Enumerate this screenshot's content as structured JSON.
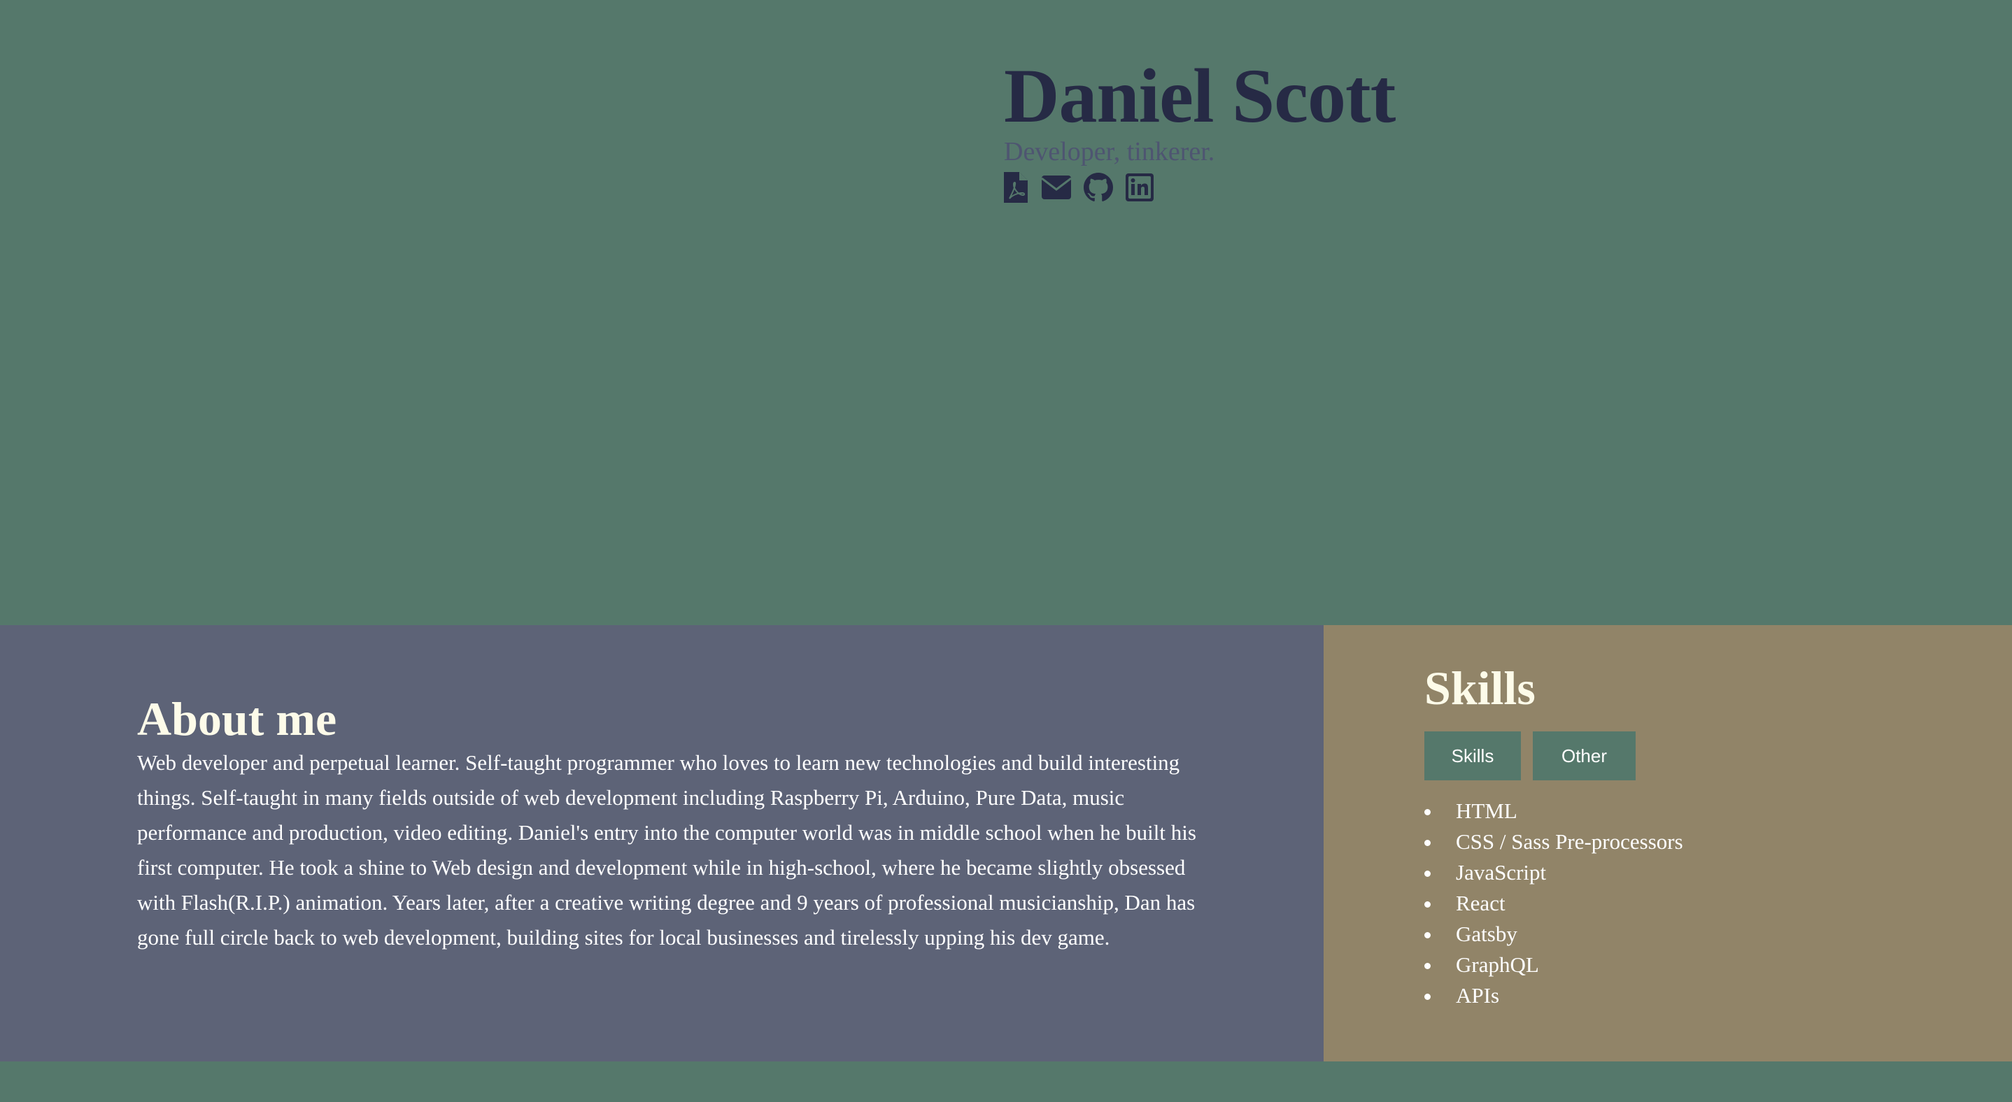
{
  "hero": {
    "name": "Daniel Scott",
    "tagline": "Developer, tinkerer.",
    "links": [
      {
        "icon": "pdf-file-icon"
      },
      {
        "icon": "envelope-icon"
      },
      {
        "icon": "github-icon"
      },
      {
        "icon": "linkedin-icon"
      }
    ]
  },
  "about": {
    "title": "About me",
    "text": "Web developer and perpetual learner. Self-taught programmer who loves to learn new technologies and build interesting things. Self-taught in many fields outside of web development including Raspberry Pi, Arduino, Pure Data, music performance and production, video editing. Daniel's entry into the computer world was in middle school when he built his first computer. He took a shine to Web design and development while in high-school, where he became slightly obsessed with Flash(R.I.P.) animation. Years later, after a creative writing degree and 9 years of professional musicianship, Dan has gone full circle back to web development, building sites for local businesses and tirelessly upping his dev game."
  },
  "skills": {
    "title": "Skills",
    "tabs": [
      "Skills",
      "Other"
    ],
    "items": [
      "HTML",
      "CSS / Sass Pre-processors",
      "JavaScript",
      "React",
      "Gatsby",
      "GraphQL",
      "APIs"
    ]
  },
  "colors": {
    "background": "#55786b",
    "name": "#262a45",
    "about_bg": "#5d6377",
    "skills_bg": "#918468",
    "heading": "#fdfbe9"
  }
}
